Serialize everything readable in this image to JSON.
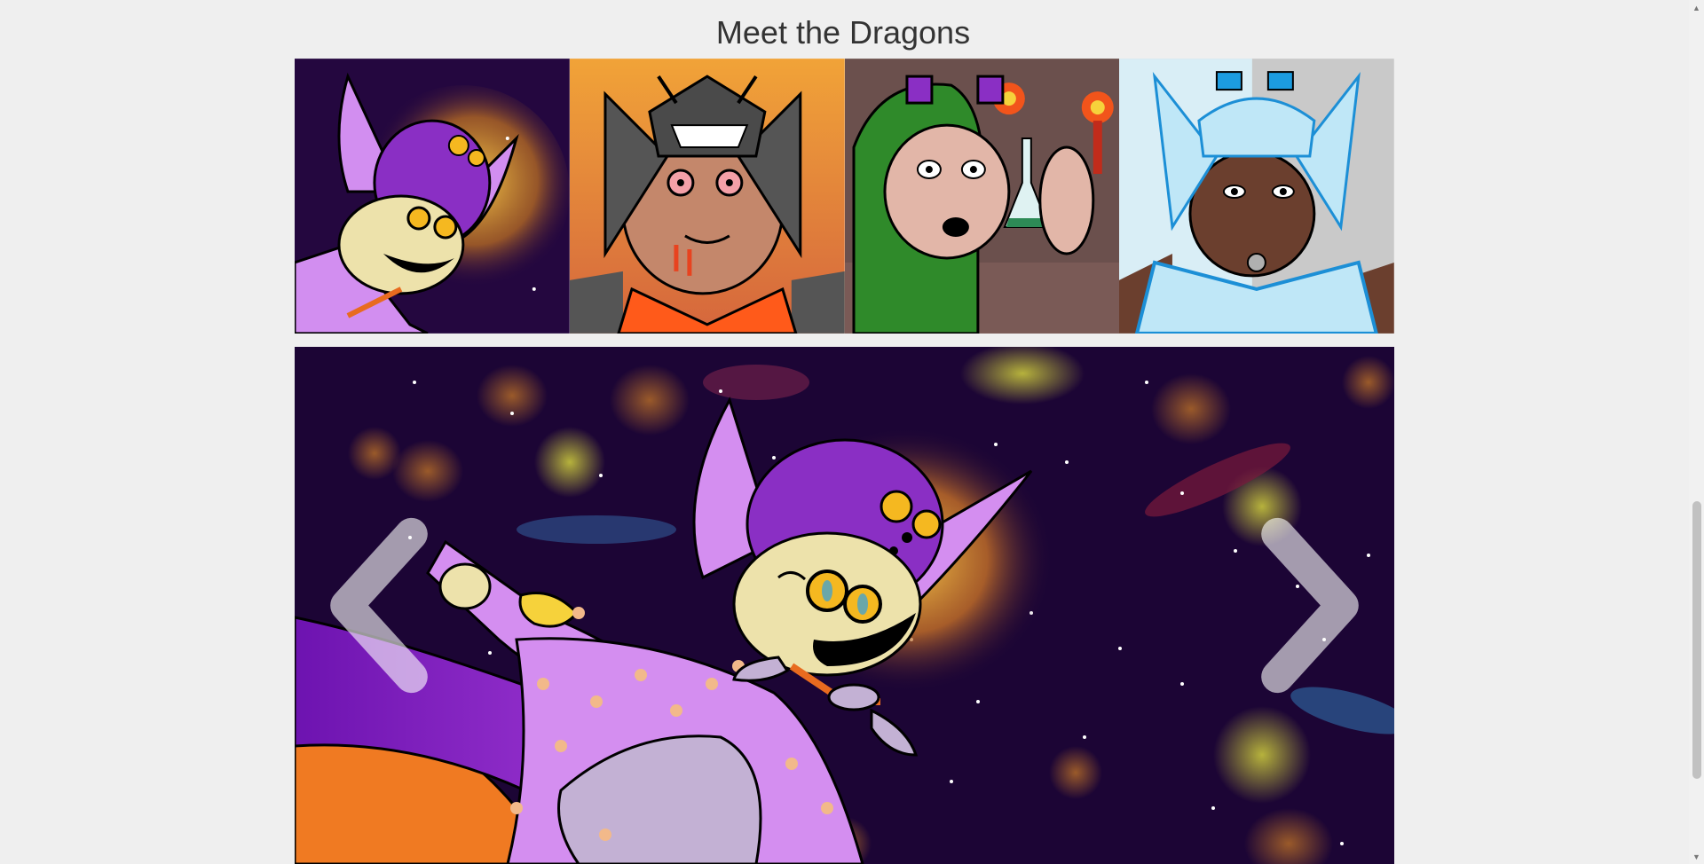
{
  "section": {
    "title": "Meet the Dragons"
  },
  "thumbnails": [
    {
      "name": "purple-wizard-dragon-thumbnail"
    },
    {
      "name": "orange-fire-dragon-thumbnail"
    },
    {
      "name": "green-alchemist-dragon-thumbnail"
    },
    {
      "name": "ice-blue-dragon-thumbnail"
    }
  ],
  "carousel": {
    "active_slide": "purple-wizard-dragon",
    "prev_icon": "chevron-left-icon",
    "next_icon": "chevron-right-icon"
  },
  "colors": {
    "page_background": "#efefef",
    "title_text": "#333333",
    "space_background": "#1c0535",
    "hood_purple": "#8a2fc4",
    "cape_lilac": "#d48ef0",
    "fire_orange": "#f07a22",
    "dragon_green": "#2e8a2a",
    "ice_blue": "#bfe7f7"
  }
}
